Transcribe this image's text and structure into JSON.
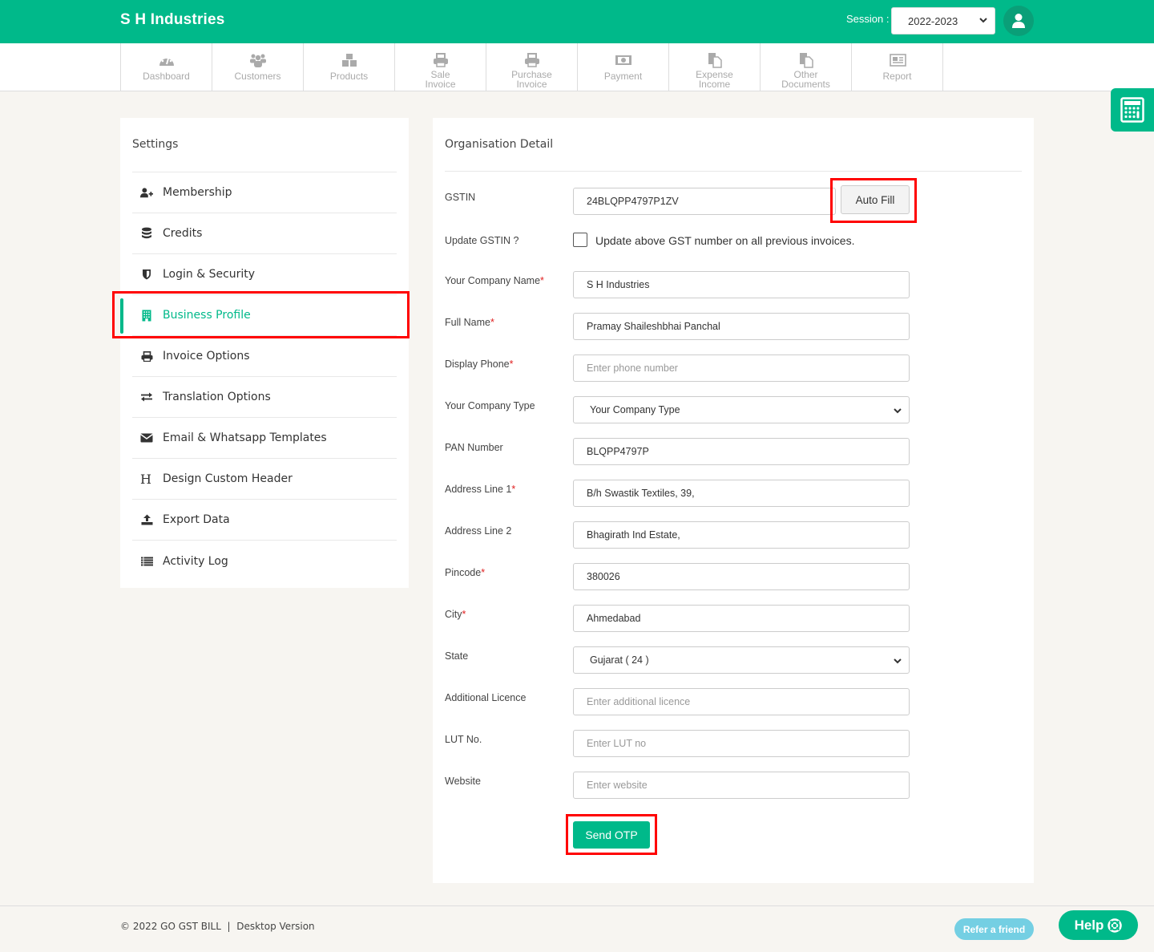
{
  "header": {
    "brand": "S H Industries",
    "session_label": "Session :",
    "session_value": "2022-2023"
  },
  "nav": [
    {
      "label": "Dashboard",
      "icon": "dashboard-icon"
    },
    {
      "label": "Customers",
      "icon": "users-icon"
    },
    {
      "label": "Products",
      "icon": "cubes-icon"
    },
    {
      "label": "Sale\nInvoice",
      "icon": "printer-icon"
    },
    {
      "label": "Purchase\nInvoice",
      "icon": "printer-icon"
    },
    {
      "label": "Payment",
      "icon": "money-icon"
    },
    {
      "label": "Expense\nIncome",
      "icon": "documents-icon"
    },
    {
      "label": "Other\nDocuments",
      "icon": "documents-icon"
    },
    {
      "label": "Report",
      "icon": "newspaper-icon"
    }
  ],
  "settings": {
    "title": "Settings",
    "items": [
      {
        "label": "Membership",
        "icon": "user-plus-icon"
      },
      {
        "label": "Credits",
        "icon": "database-icon"
      },
      {
        "label": "Login & Security",
        "icon": "shield-icon"
      },
      {
        "label": "Business Profile",
        "icon": "building-icon",
        "active": true
      },
      {
        "label": "Invoice Options",
        "icon": "printer-icon"
      },
      {
        "label": "Translation Options",
        "icon": "exchange-icon"
      },
      {
        "label": "Email & Whatsapp Templates",
        "icon": "envelope-icon"
      },
      {
        "label": "Design Custom Header",
        "icon": "header-icon"
      },
      {
        "label": "Export Data",
        "icon": "upload-icon"
      },
      {
        "label": "Activity Log",
        "icon": "list-icon"
      }
    ]
  },
  "org": {
    "title": "Organisation Detail",
    "gstin": {
      "label": "GSTIN",
      "value": "24BLQPP4797P1ZV"
    },
    "autofill_label": "Auto Fill",
    "update_gstin": {
      "label": "Update GSTIN ?",
      "text": "Update above GST number on all previous invoices.",
      "checked": false
    },
    "fields": [
      {
        "label": "Your Company Name",
        "required": true,
        "value": "S H Industries",
        "placeholder": ""
      },
      {
        "label": "Full Name",
        "required": true,
        "value": "Pramay Shaileshbhai Panchal",
        "placeholder": ""
      },
      {
        "label": "Display Phone",
        "required": true,
        "value": "",
        "placeholder": "Enter phone number"
      },
      {
        "label": "Your Company Type",
        "required": false,
        "select": true,
        "value": "Your Company Type"
      },
      {
        "label": "PAN Number",
        "required": false,
        "value": "BLQPP4797P",
        "placeholder": ""
      },
      {
        "label": "Address Line 1",
        "required": true,
        "value": "B/h Swastik Textiles, 39,",
        "placeholder": ""
      },
      {
        "label": "Address Line 2",
        "required": false,
        "value": "Bhagirath Ind Estate,",
        "placeholder": ""
      },
      {
        "label": "Pincode",
        "required": true,
        "value": "380026",
        "placeholder": ""
      },
      {
        "label": "City",
        "required": true,
        "value": "Ahmedabad",
        "placeholder": ""
      },
      {
        "label": "State",
        "required": false,
        "select": true,
        "value": "Gujarat ( 24 )"
      },
      {
        "label": "Additional Licence",
        "required": false,
        "value": "",
        "placeholder": "Enter additional licence"
      },
      {
        "label": "LUT No.",
        "required": false,
        "value": "",
        "placeholder": "Enter LUT no"
      },
      {
        "label": "Website",
        "required": false,
        "value": "",
        "placeholder": "Enter website"
      }
    ],
    "required_mark": "*",
    "send_otp_label": "Send OTP"
  },
  "footer": {
    "copyright": "© 2022 GO GST BILL  |  Desktop Version",
    "refer_label": "Refer a friend",
    "help_label": "Help"
  },
  "colors": {
    "brand": "#00b98a",
    "highlight": "#ff0000",
    "refer": "#74cfe3",
    "required": "#e02020"
  }
}
